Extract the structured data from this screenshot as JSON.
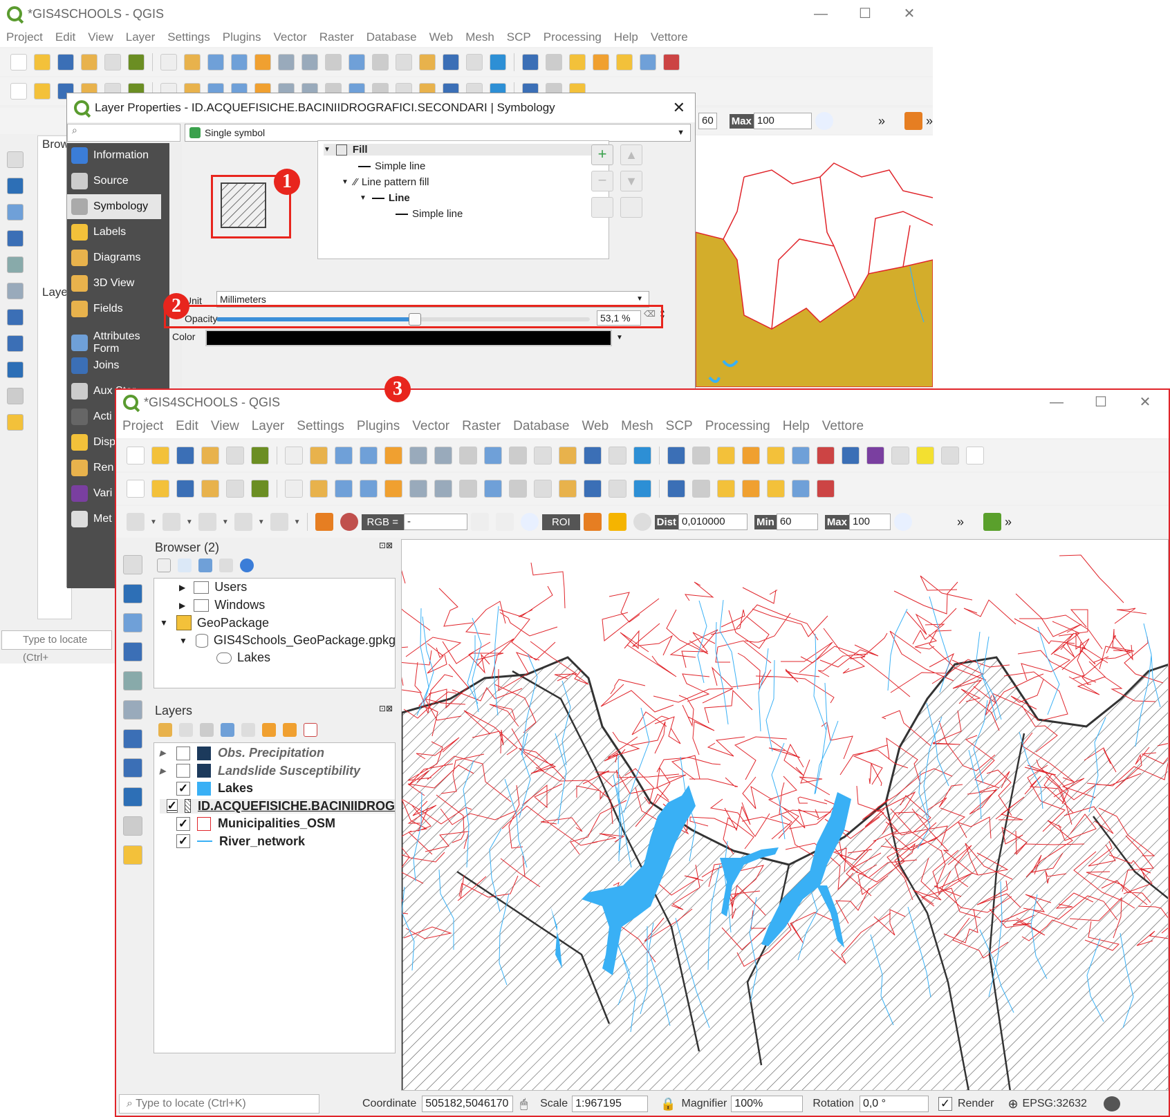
{
  "back_window": {
    "title": "*GIS4SCHOOLS - QGIS",
    "menus": [
      "Project",
      "Edit",
      "View",
      "Layer",
      "Settings",
      "Plugins",
      "Vector",
      "Raster",
      "Database",
      "Web",
      "Mesh",
      "SCP",
      "Processing",
      "Help",
      "Vettore"
    ],
    "min_value": "60",
    "max_label": "Max",
    "max_value": "100",
    "browser_label": "Brow",
    "layers_label": "Laye",
    "locate_placeholder": "Type to locate (Ctrl+"
  },
  "dialog": {
    "title": "Layer Properties - ID.ACQUEFISICHE.BACINIIDROGRAFICI.SECONDARI | Symbology",
    "renderer": "Single symbol",
    "nav": [
      "Information",
      "Source",
      "Symbology",
      "Labels",
      "Diagrams",
      "3D View",
      "Fields",
      "Attributes Form",
      "Joins",
      "Aux Stor",
      "Acti",
      "Disp",
      "Ren",
      "Vari",
      "Met"
    ],
    "tree": {
      "fill": "Fill",
      "simple_line": "Simple line",
      "line_pattern": "Line pattern fill",
      "line": "Line",
      "simple_line2": "Simple line"
    },
    "unit_label": "Unit",
    "unit_value": "Millimeters",
    "opacity_label": "Opacity",
    "opacity_value": "53,1 %",
    "opacity_fraction": 0.531,
    "color_label": "Color",
    "color_value": "#000000"
  },
  "badges": [
    "1",
    "2",
    "3"
  ],
  "front_window": {
    "title": "*GIS4SCHOOLS - QGIS",
    "menus": [
      "Project",
      "Edit",
      "View",
      "Layer",
      "Settings",
      "Plugins",
      "Vector",
      "Raster",
      "Database",
      "Web",
      "Mesh",
      "SCP",
      "Processing",
      "Help",
      "Vettore"
    ],
    "scp": {
      "rgb_label": "RGB =",
      "rgb_value": "-",
      "roi_label": "ROI",
      "dist_label": "Dist",
      "dist_value": "0,010000",
      "min_label": "Min",
      "min_value": "60",
      "max_label": "Max",
      "max_value": "100"
    },
    "browser": {
      "title": "Browser (2)",
      "items": [
        "Users",
        "Windows",
        "GeoPackage",
        "GIS4Schools_GeoPackage.gpkg",
        "Lakes"
      ]
    },
    "layers": {
      "title": "Layers",
      "items": [
        {
          "name": "Obs. Precipitation",
          "checked": false
        },
        {
          "name": "Landslide Susceptibility",
          "checked": false
        },
        {
          "name": "Lakes",
          "checked": true
        },
        {
          "name": "ID.ACQUEFISICHE.BACINIIDROG",
          "checked": true
        },
        {
          "name": "Municipalities_OSM",
          "checked": true
        },
        {
          "name": "River_network",
          "checked": true
        }
      ]
    },
    "status": {
      "locate_placeholder": "Type to locate (Ctrl+K)",
      "coordinate_label": "Coordinate",
      "coordinate_value": "505182,5046170",
      "scale_label": "Scale",
      "scale_value": "1:967195",
      "magnifier_label": "Magnifier",
      "magnifier_value": "100%",
      "rotation_label": "Rotation",
      "rotation_value": "0,0 °",
      "render_label": "Render",
      "crs": "EPSG:32632"
    }
  },
  "colors": {
    "accent_red": "#e8251d",
    "lake_blue": "#39b0f5",
    "basin_yellow": "#d3ad2b",
    "boundary_red": "#e0242a",
    "nav_dark": "#4d4d4d",
    "slider_blue": "#3a8fd9"
  }
}
